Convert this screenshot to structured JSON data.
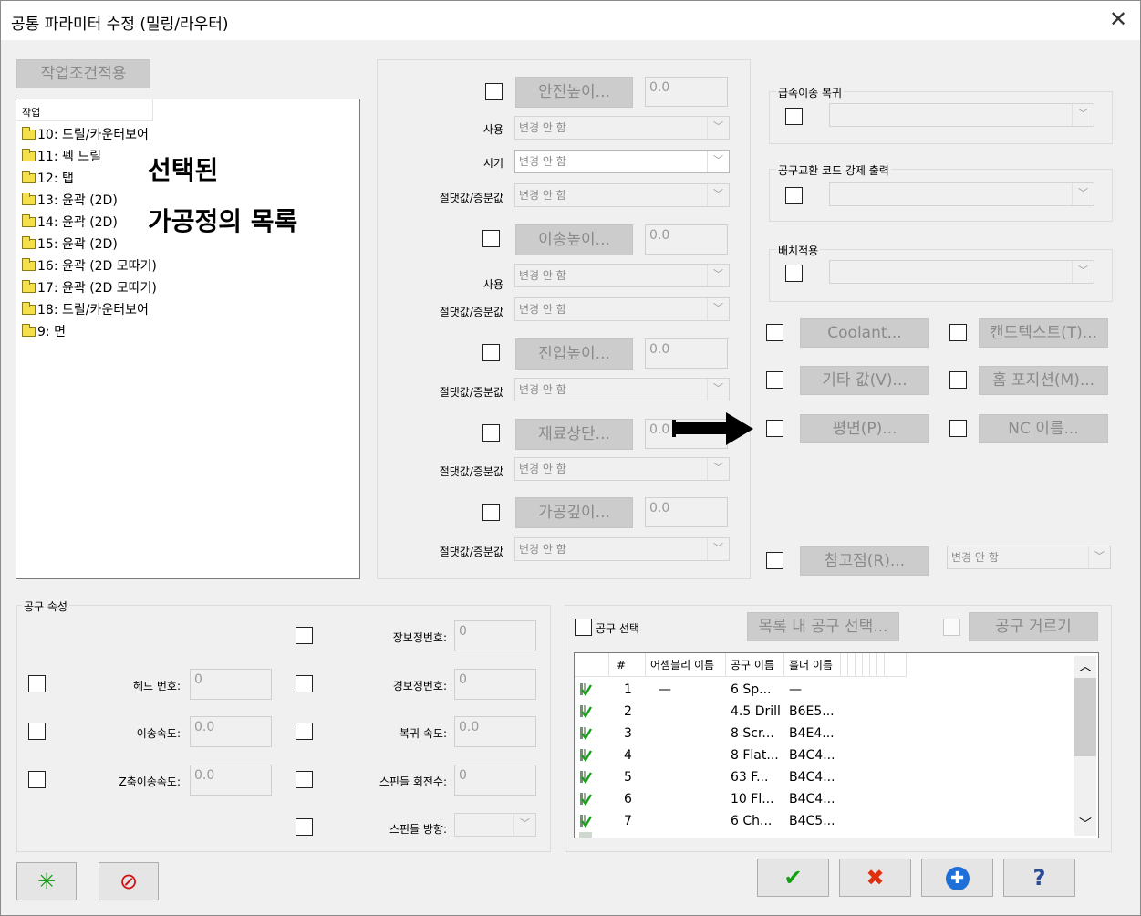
{
  "window": {
    "title": "공통 파라미터 수정 (밀링/라우터)",
    "close_glyph": "✕"
  },
  "apply_button": "작업조건적용",
  "tree": {
    "header": "작업",
    "items": [
      "10: 드릴/카운터보어",
      "11: 펙 드릴",
      "12: 탭",
      "13: 윤곽 (2D)",
      "14: 윤곽 (2D)",
      "15: 윤곽 (2D)",
      "16: 윤곽 (2D 모따기)",
      "17: 윤곽 (2D 모따기)",
      "18: 드릴/카운터보어",
      "9: 면"
    ]
  },
  "annotation": {
    "line1": "선택된",
    "line2": "가공정의 목록"
  },
  "heights": {
    "clearance": {
      "button": "안전높이...",
      "value": "0.0",
      "use_label": "사용",
      "use_value": "변경 안 함",
      "when_label": "시기",
      "when_value": "변경 안 함",
      "abs_label": "절댓값/증분값",
      "abs_value": "변경 안 함"
    },
    "retract": {
      "button": "이송높이...",
      "value": "0.0",
      "use_label": "사용",
      "use_value": "변경 안 함",
      "abs_label": "절댓값/증분값",
      "abs_value": "변경 안 함"
    },
    "feed_plane": {
      "button": "진입높이...",
      "value": "0.0",
      "abs_label": "절댓값/증분값",
      "abs_value": "변경 안 함"
    },
    "top_of_stock": {
      "button": "재료상단...",
      "value": "0.0",
      "abs_label": "절댓값/증분값",
      "abs_value": "변경 안 함"
    },
    "depth": {
      "button": "가공깊이...",
      "value": "0.0",
      "abs_label": "절댓값/증분값",
      "abs_value": "변경 안 함"
    }
  },
  "right_groups": {
    "rapid_return": "급속이송 복귀",
    "tool_change_force": "공구교환 코드 강제 출력",
    "batch_apply": "배치적용"
  },
  "right_buttons": {
    "coolant": "Coolant...",
    "canned_text": "캔드텍스트(T)...",
    "misc_values": "기타 값(V)...",
    "home_position": "홈 포지션(M)...",
    "plane": "평면(P)...",
    "nc_name": "NC 이름...",
    "reference_point": "참고점(R)...",
    "reference_combo": "변경 안 함"
  },
  "tool_properties": {
    "group_label": "공구 속성",
    "head_no": {
      "label": "헤드 번호:",
      "value": "0"
    },
    "feed_rate": {
      "label": "이송속도:",
      "value": "0.0"
    },
    "z_feed": {
      "label": "Z축이송속도:",
      "value": "0.0"
    },
    "length_offset": {
      "label": "장보정번호:",
      "value": "0"
    },
    "diameter_offset": {
      "label": "경보정번호:",
      "value": "0"
    },
    "retract_rate": {
      "label": "복귀 속도:",
      "value": "0.0"
    },
    "spindle_speed": {
      "label": "스핀들 회전수:",
      "value": "0"
    },
    "spindle_dir": {
      "label": "스핀들 방향:",
      "value": ""
    }
  },
  "tool_select": {
    "checkbox_label": "공구 선택",
    "select_in_list_button": "목록 내 공구 선택...",
    "filter_button": "공구 거르기",
    "columns": [
      "#",
      "어셈블리 이름",
      "공구 이름",
      "홀더 이름"
    ],
    "rows": [
      {
        "num": "1",
        "assembly": "—",
        "tool": "6 Sp...",
        "holder": "—"
      },
      {
        "num": "2",
        "assembly": "",
        "tool": "4.5 Drill",
        "holder": "B6E5..."
      },
      {
        "num": "3",
        "assembly": "",
        "tool": "8 Scr...",
        "holder": "B4E4..."
      },
      {
        "num": "4",
        "assembly": "",
        "tool": "8 Flat...",
        "holder": "B4C4..."
      },
      {
        "num": "5",
        "assembly": "",
        "tool": "63 F...",
        "holder": "B4C4..."
      },
      {
        "num": "6",
        "assembly": "",
        "tool": "10 Fl...",
        "holder": "B4C4..."
      },
      {
        "num": "7",
        "assembly": "",
        "tool": "6 Ch...",
        "holder": "B4C5..."
      }
    ]
  },
  "bottom_buttons": {
    "reset_glyph": "✳",
    "clear_glyph": "⊘",
    "ok_glyph": "✔",
    "cancel_glyph": "✖",
    "apply_glyph": "✚",
    "help_glyph": "?"
  }
}
